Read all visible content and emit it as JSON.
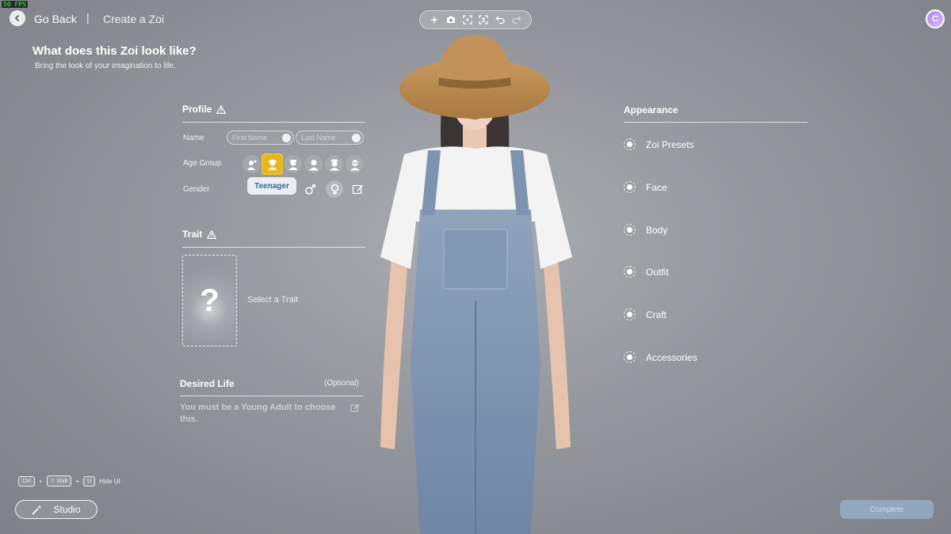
{
  "fps": "50 FPS",
  "header": {
    "go_back": "Go Back",
    "separator": "|",
    "breadcrumb": "Create a Zoi",
    "avatar_letter": "C"
  },
  "toolbar": {
    "icons": [
      "sparkle-icon",
      "camera-icon",
      "frame-icon",
      "focus-icon",
      "undo-icon",
      "redo-icon"
    ]
  },
  "page": {
    "title": "What does this Zoi look like?",
    "subtitle": "Bring the look of your imagination to life."
  },
  "profile": {
    "title": "Profile",
    "name_label": "Name",
    "first_name_placeholder": "First Name",
    "last_name_placeholder": "Last Name",
    "age_group_label": "Age Group",
    "age_groups": [
      "Infant",
      "Teenager",
      "Young Adult",
      "Adult",
      "Middle-aged",
      "Elder"
    ],
    "selected_age_group": "Teenager",
    "gender_label": "Gender",
    "selected_gender": "female"
  },
  "trait": {
    "title": "Trait",
    "card_symbol": "?",
    "select_text": "Select a Trait"
  },
  "desired_life": {
    "title": "Desired Life",
    "optional": "(Optional)",
    "text": "You must be a Young Adult to choose this."
  },
  "appearance": {
    "title": "Appearance",
    "items": [
      "Zoi Presets",
      "Face",
      "Body",
      "Outfit",
      "Craft",
      "Accessories"
    ]
  },
  "shortcut": {
    "key1": "Ctrl",
    "plus": "+",
    "key2": "⇧ Shift",
    "key3": "U",
    "label": "Hide UI"
  },
  "studio_label": "Studio",
  "complete_label": "Complete",
  "colors": {
    "highlight": "#e6b51f",
    "tooltip_text": "#2d6ba8",
    "complete_bg": "#9bbee1"
  }
}
